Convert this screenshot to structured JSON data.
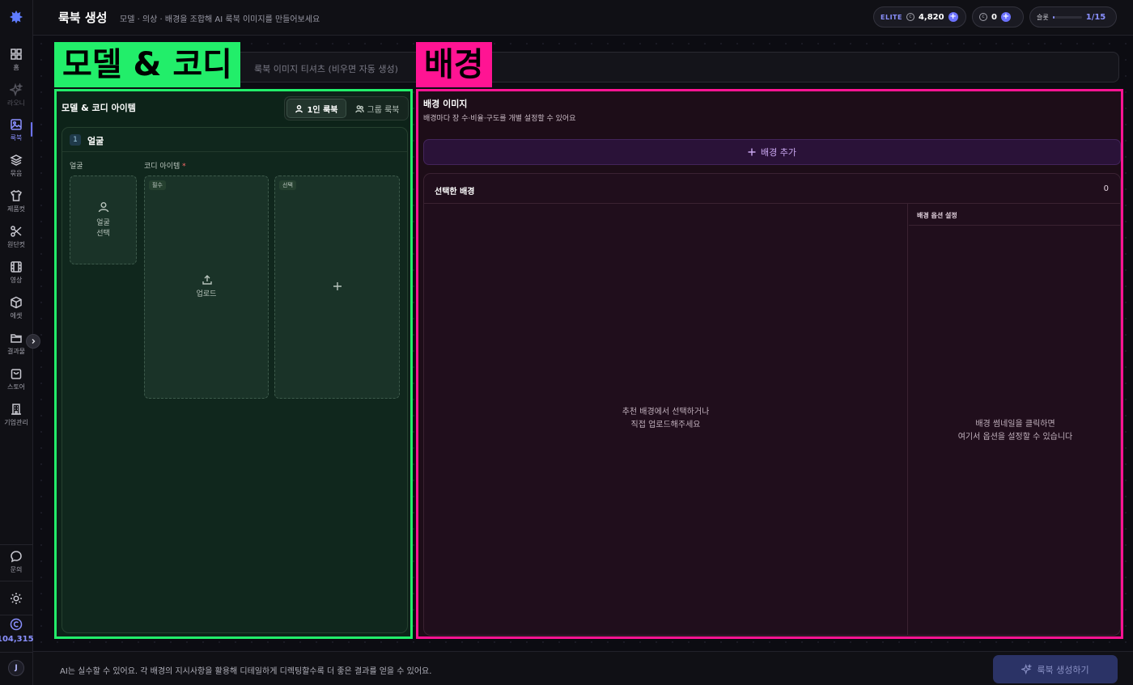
{
  "header": {
    "title": "룩북 생성",
    "subtitle": "모델 · 의상 · 배경을 조합해 AI 룩북 이미지를 만들어보세요",
    "tier": "ELITE",
    "credits": "4,820",
    "secondary_credits": "0",
    "slot_label": "슬롯",
    "slot_value": "1/15",
    "slot_progress": 0.07
  },
  "sidebar": {
    "items": [
      {
        "label": "홈",
        "icon": "grid-icon"
      },
      {
        "label": "라오니",
        "icon": "sparkle-icon"
      },
      {
        "label": "룩북",
        "icon": "image-icon"
      },
      {
        "label": "묶음",
        "icon": "layers-icon"
      },
      {
        "label": "제품컷",
        "icon": "shirt-icon"
      },
      {
        "label": "원단컷",
        "icon": "scissors-icon"
      },
      {
        "label": "영상",
        "icon": "film-icon"
      },
      {
        "label": "에셋",
        "icon": "cube-icon"
      },
      {
        "label": "결과물",
        "icon": "folder-icon"
      },
      {
        "label": "스토어",
        "icon": "bag-icon"
      },
      {
        "label": "기업관리",
        "icon": "building-icon"
      }
    ],
    "inquiry_label": "문의",
    "credit_total": "104,315",
    "avatar_initial": "J"
  },
  "prompt": {
    "placeholder": "룩북 이미지 티셔츠 (비우면 자동 생성)"
  },
  "annotations": {
    "model_label": "모델 & 코디",
    "bg_label": "배경",
    "model_color": "#22ee6a",
    "bg_color": "#ff1493"
  },
  "model_panel": {
    "title": "모델 & 코디 아이템",
    "mode_single": "1인 룩북",
    "mode_group": "그룹 룩북",
    "card_number": "1",
    "card_title": "얼굴",
    "face_label": "얼굴",
    "coordi_label": "코디 아이템",
    "face_slot_text_1": "얼굴",
    "face_slot_text_2": "선택",
    "required_tag": "필수",
    "upload_text": "업로드",
    "optional_tag": "선택"
  },
  "bg_panel": {
    "title": "배경 이미지",
    "subtitle": "배경마다 장 수·비율·구도를 개별 설정할 수 있어요",
    "add_button": "배경 추가",
    "selected_title": "선택한 배경",
    "selected_count": "0",
    "empty_line_1": "추천 배경에서 선택하거나",
    "empty_line_2": "직접 업로드해주세요",
    "options_title": "배경 옵션 설정",
    "options_line_1": "배경 썸네일을 클릭하면",
    "options_line_2": "여기서 옵션을 설정할 수 있습니다"
  },
  "footer": {
    "note": "AI는 실수할 수 있어요. 각 배경의 지시사항을 활용해 디테일하게 디렉팅할수록 더 좋은 결과를 얻을 수 있어요.",
    "generate_button": "룩북 생성하기"
  }
}
